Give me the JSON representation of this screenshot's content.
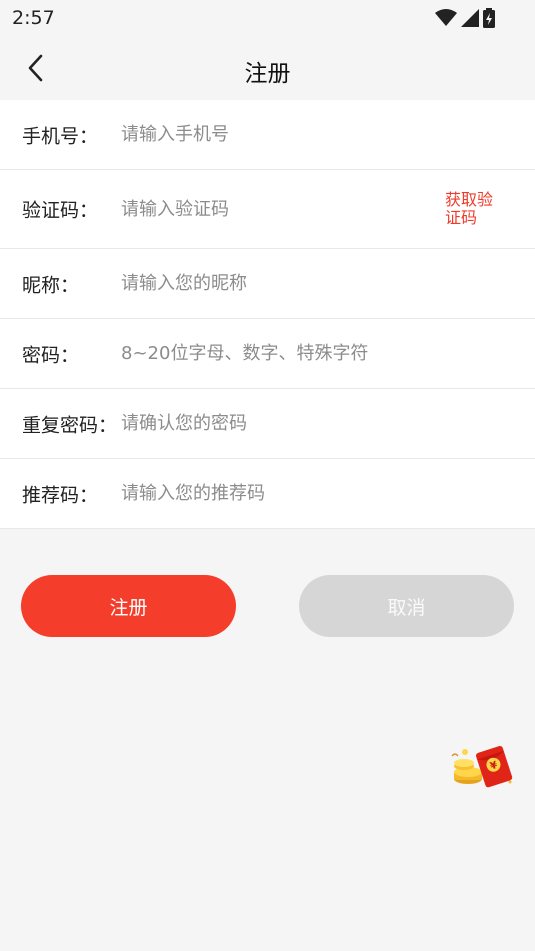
{
  "status_bar": {
    "time": "2:57"
  },
  "nav": {
    "title": "注册"
  },
  "form": {
    "rows": [
      {
        "label": "手机号：",
        "placeholder": "请输入手机号"
      },
      {
        "label": "验证码：",
        "placeholder": "请输入验证码",
        "action": "获取验证码"
      },
      {
        "label": "昵称：",
        "placeholder": "请输入您的昵称"
      },
      {
        "label": "密码：",
        "placeholder": "8~20位字母、数字、特殊字符"
      },
      {
        "label": "重复密码：",
        "placeholder": "请确认您的密码"
      },
      {
        "label": "推荐码：",
        "placeholder": "请输入您的推荐码"
      }
    ]
  },
  "buttons": {
    "register": "注册",
    "cancel": "取消"
  },
  "colors": {
    "accent": "#f43d2b",
    "link": "#f03a2a",
    "disabled": "#d6d6d6",
    "background": "#f5f5f5"
  },
  "icons": {
    "back": "chevron-left-icon",
    "wifi": "wifi-icon",
    "signal": "signal-icon",
    "battery": "battery-icon",
    "red_packet": "red-packet-icon"
  }
}
